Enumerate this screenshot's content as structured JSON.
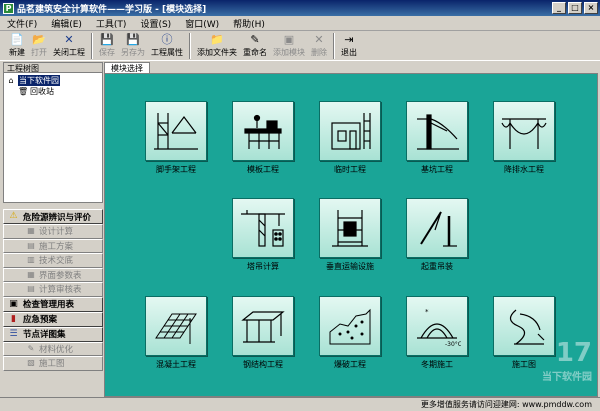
{
  "window": {
    "title": "品茗建筑安全计算软件——学习版 - [模块选择]",
    "app_icon": "P",
    "buttons": [
      "minimize",
      "maximize",
      "close"
    ]
  },
  "menu": [
    {
      "label": "文件(F)"
    },
    {
      "label": "编辑(E)"
    },
    {
      "label": "工具(T)"
    },
    {
      "label": "设置(S)"
    },
    {
      "label": "窗口(W)"
    },
    {
      "label": "帮助(H)"
    }
  ],
  "toolbar": [
    {
      "label": "新建",
      "icon": "new-file-icon",
      "enabled": true
    },
    {
      "label": "打开",
      "icon": "open-folder-icon",
      "enabled": false
    },
    {
      "label": "关闭工程",
      "icon": "close-icon",
      "enabled": true
    },
    {
      "label": "保存",
      "icon": "save-icon",
      "enabled": false
    },
    {
      "label": "另存为",
      "icon": "save-as-icon",
      "enabled": false
    },
    {
      "label": "工程属性",
      "icon": "info-icon",
      "enabled": true
    },
    {
      "label": "添加文件夹",
      "icon": "add-folder-icon",
      "enabled": true
    },
    {
      "label": "重命名",
      "icon": "rename-icon",
      "enabled": true
    },
    {
      "label": "添加模块",
      "icon": "add-module-icon",
      "enabled": false
    },
    {
      "label": "删除",
      "icon": "delete-icon",
      "enabled": false
    },
    {
      "label": "退出",
      "icon": "exit-icon",
      "enabled": true
    }
  ],
  "left_panel": {
    "header": "工程树图",
    "tree": [
      {
        "label": "当下软件园",
        "selected": true,
        "icon": "house-icon"
      },
      {
        "label": "回收站",
        "selected": false,
        "icon": "recycle-bin-icon"
      }
    ],
    "nav": [
      {
        "type": "group",
        "label": "危险源辨识与评价",
        "icon": "warning-icon"
      },
      {
        "type": "sub",
        "label": "设计计算",
        "icon": "calculator-icon"
      },
      {
        "type": "sub",
        "label": "施工方案",
        "icon": "document-icon"
      },
      {
        "type": "sub",
        "label": "技术交底",
        "icon": "clipboard-icon"
      },
      {
        "type": "sub",
        "label": "界面参数表",
        "icon": "table-icon"
      },
      {
        "type": "sub",
        "label": "计算审核表",
        "icon": "checklist-icon"
      },
      {
        "type": "group",
        "label": "检查管理用表",
        "icon": "folder-icon"
      },
      {
        "type": "group",
        "label": "应急预案",
        "icon": "book-icon"
      },
      {
        "type": "group",
        "label": "节点详图集",
        "icon": "stack-icon"
      },
      {
        "type": "sub",
        "label": "材料优化",
        "icon": "pencil-icon"
      },
      {
        "type": "sub",
        "label": "施工图",
        "icon": "drawing-icon"
      }
    ]
  },
  "main": {
    "tab": "模块选择",
    "modules": [
      {
        "label": "脚手架工程",
        "icon": "scaffold-icon"
      },
      {
        "label": "模板工程",
        "icon": "formwork-icon"
      },
      {
        "label": "临时工程",
        "icon": "temporary-works-icon"
      },
      {
        "label": "基坑工程",
        "icon": "foundation-pit-icon"
      },
      {
        "label": "降排水工程",
        "icon": "dewatering-icon"
      },
      {
        "label": "塔吊计算",
        "icon": "tower-crane-icon"
      },
      {
        "label": "垂直运输设施",
        "icon": "hoist-icon"
      },
      {
        "label": "起重吊装",
        "icon": "lifting-icon"
      },
      {
        "label": "混凝土工程",
        "icon": "concrete-icon"
      },
      {
        "label": "钢结构工程",
        "icon": "steel-structure-icon"
      },
      {
        "label": "爆破工程",
        "icon": "blasting-icon"
      },
      {
        "label": "冬期施工",
        "icon": "winter-construction-icon"
      },
      {
        "label": "施工图",
        "icon": "construction-drawing-icon"
      }
    ]
  },
  "status": {
    "text": "更多增值服务请访问迎建网: www.pmddw.com"
  },
  "watermark": {
    "text": "17",
    "subtext": "当下软件园"
  }
}
